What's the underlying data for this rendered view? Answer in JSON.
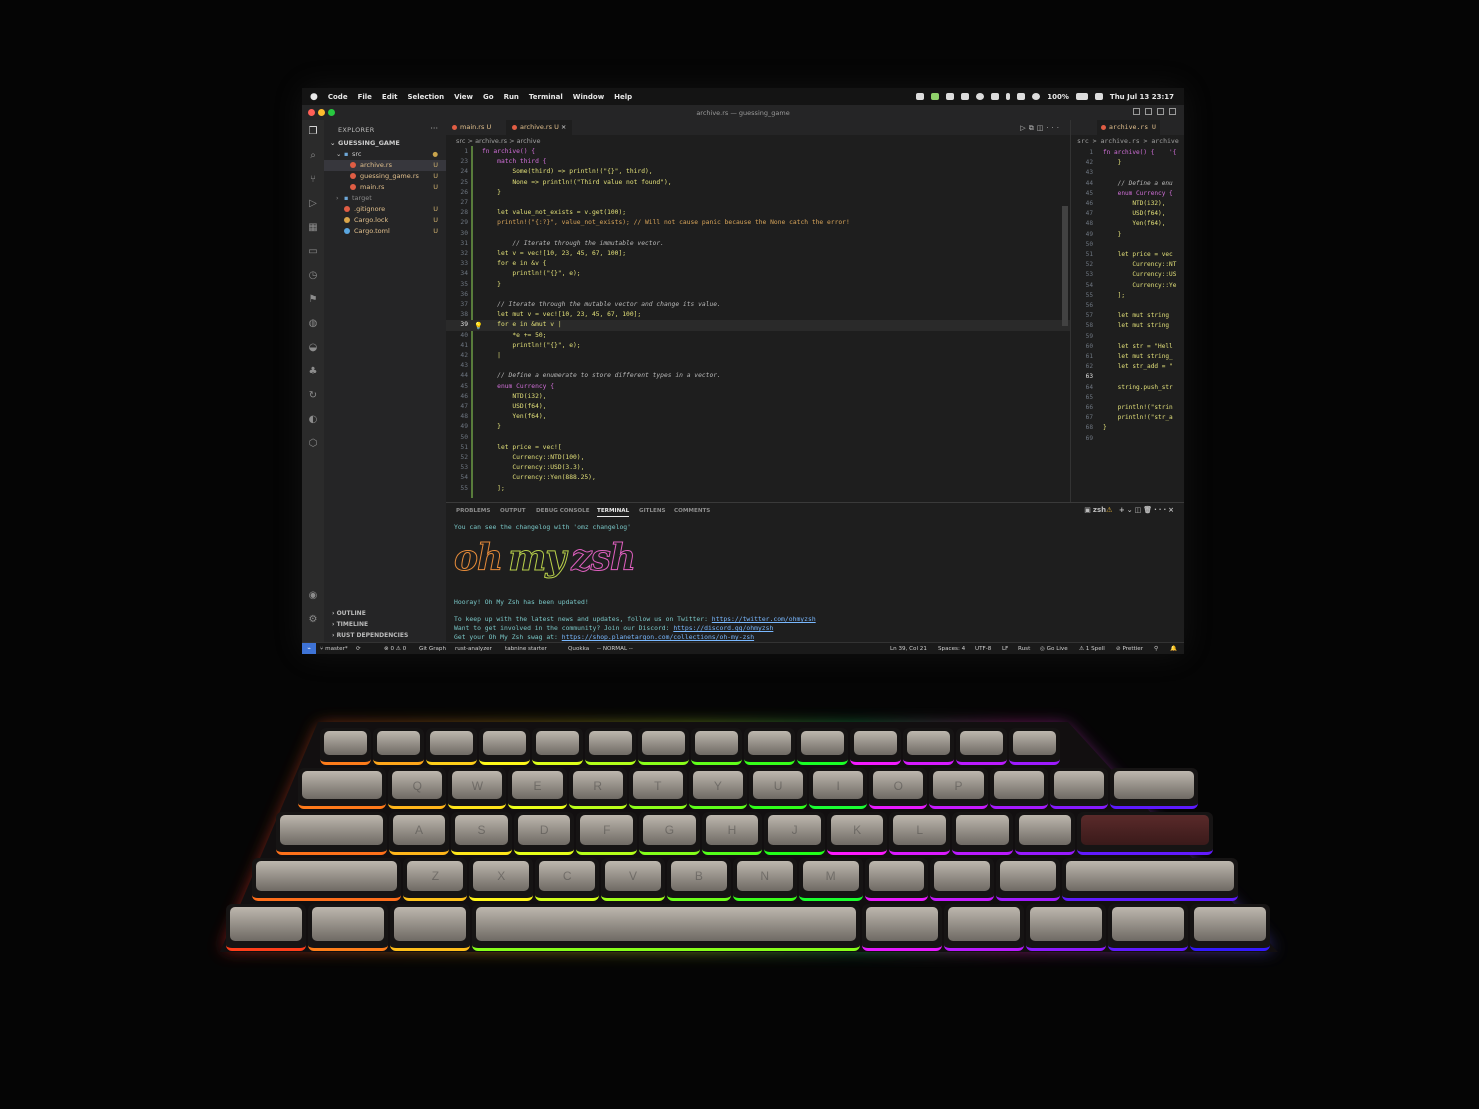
{
  "menubar": {
    "apple": "",
    "items": [
      "Code",
      "File",
      "Edit",
      "Selection",
      "View",
      "Go",
      "Run",
      "Terminal",
      "Window",
      "Help"
    ],
    "battery": "100%",
    "clock": "Thu Jul 13 23:17"
  },
  "window": {
    "title": "archive.rs — guessing_game"
  },
  "explorer": {
    "header": "EXPLORER",
    "project": "GUESSING_GAME",
    "items": [
      {
        "label": "src",
        "badge": "",
        "type": "folder-open"
      },
      {
        "label": "archive.rs",
        "badge": "U",
        "type": "rust"
      },
      {
        "label": "guessing_game.rs",
        "badge": "U",
        "type": "rust"
      },
      {
        "label": "main.rs",
        "badge": "U",
        "type": "rust"
      },
      {
        "label": "target",
        "badge": "",
        "type": "folder"
      },
      {
        "label": ".gitignore",
        "badge": "U",
        "type": "git"
      },
      {
        "label": "Cargo.lock",
        "badge": "U",
        "type": "lock"
      },
      {
        "label": "Cargo.toml",
        "badge": "U",
        "type": "toml"
      }
    ],
    "sections": [
      "OUTLINE",
      "TIMELINE",
      "RUST DEPENDENCIES"
    ]
  },
  "tabs": [
    {
      "label": "main.rs",
      "badge": "U"
    },
    {
      "label": "archive.rs",
      "badge": "U",
      "close": "×"
    }
  ],
  "breadcrumb": "src > archive.rs > archive",
  "editor": {
    "lines": [
      {
        "n": "1",
        "t": "fn archive() {",
        "c": "k"
      },
      {
        "n": "23",
        "t": "    match third {",
        "c": "k"
      },
      {
        "n": "24",
        "t": "        Some(third) => println!(\"{}\", third),",
        "c": ""
      },
      {
        "n": "25",
        "t": "        None => println!(\"Third value not found\"),",
        "c": ""
      },
      {
        "n": "26",
        "t": "    }",
        "c": ""
      },
      {
        "n": "27",
        "t": "",
        "c": ""
      },
      {
        "n": "28",
        "t": "    let value_not_exists = v.get(100);",
        "c": ""
      },
      {
        "n": "29",
        "t": "    println!(\"{:?}\", value_not_exists); // Will not cause panic because the None catch the error!",
        "c": "v"
      },
      {
        "n": "30",
        "t": "",
        "c": ""
      },
      {
        "n": "31",
        "t": "        // Iterate through the immutable vector.",
        "c": "c"
      },
      {
        "n": "32",
        "t": "    let v = vec![10, 23, 45, 67, 100];",
        "c": ""
      },
      {
        "n": "33",
        "t": "    for e in &v {",
        "c": ""
      },
      {
        "n": "34",
        "t": "        println!(\"{}\", e);",
        "c": ""
      },
      {
        "n": "35",
        "t": "    }",
        "c": ""
      },
      {
        "n": "36",
        "t": "",
        "c": ""
      },
      {
        "n": "37",
        "t": "    // Iterate through the mutable vector and change its value.",
        "c": "c"
      },
      {
        "n": "38",
        "t": "    let mut v = vec![10, 23, 45, 67, 100];",
        "c": ""
      },
      {
        "n": "39",
        "t": "    for e in &mut v |",
        "c": ""
      },
      {
        "n": "40",
        "t": "        *e += 50;",
        "c": ""
      },
      {
        "n": "41",
        "t": "        println!(\"{}\", e);",
        "c": ""
      },
      {
        "n": "42",
        "t": "    |",
        "c": ""
      },
      {
        "n": "43",
        "t": "",
        "c": ""
      },
      {
        "n": "44",
        "t": "    // Define a enumerate to store different types in a vector.",
        "c": "c"
      },
      {
        "n": "45",
        "t": "    enum Currency {",
        "c": "k"
      },
      {
        "n": "46",
        "t": "        NTD(i32),",
        "c": ""
      },
      {
        "n": "47",
        "t": "        USD(f64),",
        "c": ""
      },
      {
        "n": "48",
        "t": "        Yen(f64),",
        "c": ""
      },
      {
        "n": "49",
        "t": "    }",
        "c": ""
      },
      {
        "n": "50",
        "t": "",
        "c": ""
      },
      {
        "n": "51",
        "t": "    let price = vec![",
        "c": ""
      },
      {
        "n": "52",
        "t": "        Currency::NTD(100),",
        "c": ""
      },
      {
        "n": "53",
        "t": "        Currency::USD(3.3),",
        "c": ""
      },
      {
        "n": "54",
        "t": "        Currency::Yen(888.25),",
        "c": ""
      },
      {
        "n": "55",
        "t": "    ];",
        "c": ""
      }
    ],
    "current_line": "39"
  },
  "split": {
    "tab": "archive.rs U",
    "breadcrumb": "src > archive.rs > archive",
    "lines": [
      {
        "n": "1",
        "t": "fn archive() {    '{",
        "c": "k"
      },
      {
        "n": "42",
        "t": "    }",
        "c": ""
      },
      {
        "n": "43",
        "t": "",
        "c": ""
      },
      {
        "n": "44",
        "t": "    // Define a enu",
        "c": "c"
      },
      {
        "n": "45",
        "t": "    enum Currency {",
        "c": "k"
      },
      {
        "n": "46",
        "t": "        NTD(i32),",
        "c": ""
      },
      {
        "n": "47",
        "t": "        USD(f64),",
        "c": ""
      },
      {
        "n": "48",
        "t": "        Yen(f64),",
        "c": ""
      },
      {
        "n": "49",
        "t": "    }",
        "c": ""
      },
      {
        "n": "50",
        "t": "",
        "c": ""
      },
      {
        "n": "51",
        "t": "    let price = vec",
        "c": ""
      },
      {
        "n": "52",
        "t": "        Currency::NT",
        "c": ""
      },
      {
        "n": "53",
        "t": "        Currency::US",
        "c": ""
      },
      {
        "n": "54",
        "t": "        Currency::Ye",
        "c": ""
      },
      {
        "n": "55",
        "t": "    ];",
        "c": ""
      },
      {
        "n": "56",
        "t": "",
        "c": ""
      },
      {
        "n": "57",
        "t": "    let mut string",
        "c": ""
      },
      {
        "n": "58",
        "t": "    let mut string",
        "c": ""
      },
      {
        "n": "59",
        "t": "",
        "c": ""
      },
      {
        "n": "60",
        "t": "    let str = \"Hell",
        "c": ""
      },
      {
        "n": "61",
        "t": "    let mut string_",
        "c": ""
      },
      {
        "n": "62",
        "t": "    let str_add = \"",
        "c": ""
      },
      {
        "n": "63",
        "t": "",
        "c": ""
      },
      {
        "n": "64",
        "t": "    string.push_str",
        "c": ""
      },
      {
        "n": "65",
        "t": "",
        "c": ""
      },
      {
        "n": "66",
        "t": "    println!(\"strin",
        "c": ""
      },
      {
        "n": "67",
        "t": "    println!(\"str_a",
        "c": ""
      },
      {
        "n": "68",
        "t": "}",
        "c": ""
      },
      {
        "n": "69",
        "t": "",
        "c": ""
      }
    ]
  },
  "panel": {
    "tabs": [
      "PROBLEMS",
      "OUTPUT",
      "DEBUG CONSOLE",
      "TERMINAL",
      "GITLENS",
      "COMMENTS"
    ],
    "active_tab": "TERMINAL",
    "shell": "zsh",
    "terminal": {
      "changelog": "You can see the changelog with 'omz changelog'",
      "banner": [
        "oh",
        "my",
        "zsh"
      ],
      "hooray": "Hooray! Oh My Zsh has been updated!",
      "twitter_text": "To keep up with the latest news and updates, follow us on Twitter: ",
      "twitter_link": "https://twitter.com/ohmyzsh",
      "discord_text": "Want to get involved in the community? Join our Discord: ",
      "discord_link": "https://discord.gg/ohmyzsh",
      "swag_text": "Get your Oh My Zsh swag at: ",
      "swag_link": "https://shop.planetargon.com/collections/oh-my-zsh"
    }
  },
  "statusbar": {
    "branch": "master*",
    "problems": "⊗ 0 ⚠ 0",
    "git_graph": "Git Graph",
    "analyzer": "rust-analyzer",
    "tabnine": "tabnine starter",
    "quokka": "Quokka",
    "mode": "-- NORMAL --",
    "position": "Ln 39, Col 21",
    "spaces": "Spaces: 4",
    "encoding": "UTF-8",
    "eol": "LF",
    "language": "Rust",
    "golive": "Go Live",
    "spell": "1 Spell",
    "prettier": "Prettier"
  },
  "colors": {
    "code_yellow": "#e2e079",
    "keyword_pink": "#d16fd9",
    "comment": "#b9b9b9",
    "link": "#79b8ff",
    "accent_blue": "#3e73d6"
  },
  "keyboard": {
    "rows": [
      [
        "",
        "",
        "",
        "",
        "",
        "",
        "",
        "",
        "",
        "",
        "",
        "",
        "",
        ""
      ],
      [
        "",
        "Q",
        "W",
        "E",
        "R",
        "T",
        "Y",
        "U",
        "I",
        "O",
        "P",
        "",
        "",
        ""
      ],
      [
        "",
        "A",
        "S",
        "D",
        "F",
        "G",
        "H",
        "J",
        "K",
        "L",
        "",
        "",
        ""
      ],
      [
        "",
        "Z",
        "X",
        "C",
        "V",
        "B",
        "N",
        "M",
        "",
        "",
        "",
        ""
      ],
      [
        "",
        "",
        "",
        "",
        "",
        "",
        "",
        "",
        ""
      ]
    ]
  }
}
